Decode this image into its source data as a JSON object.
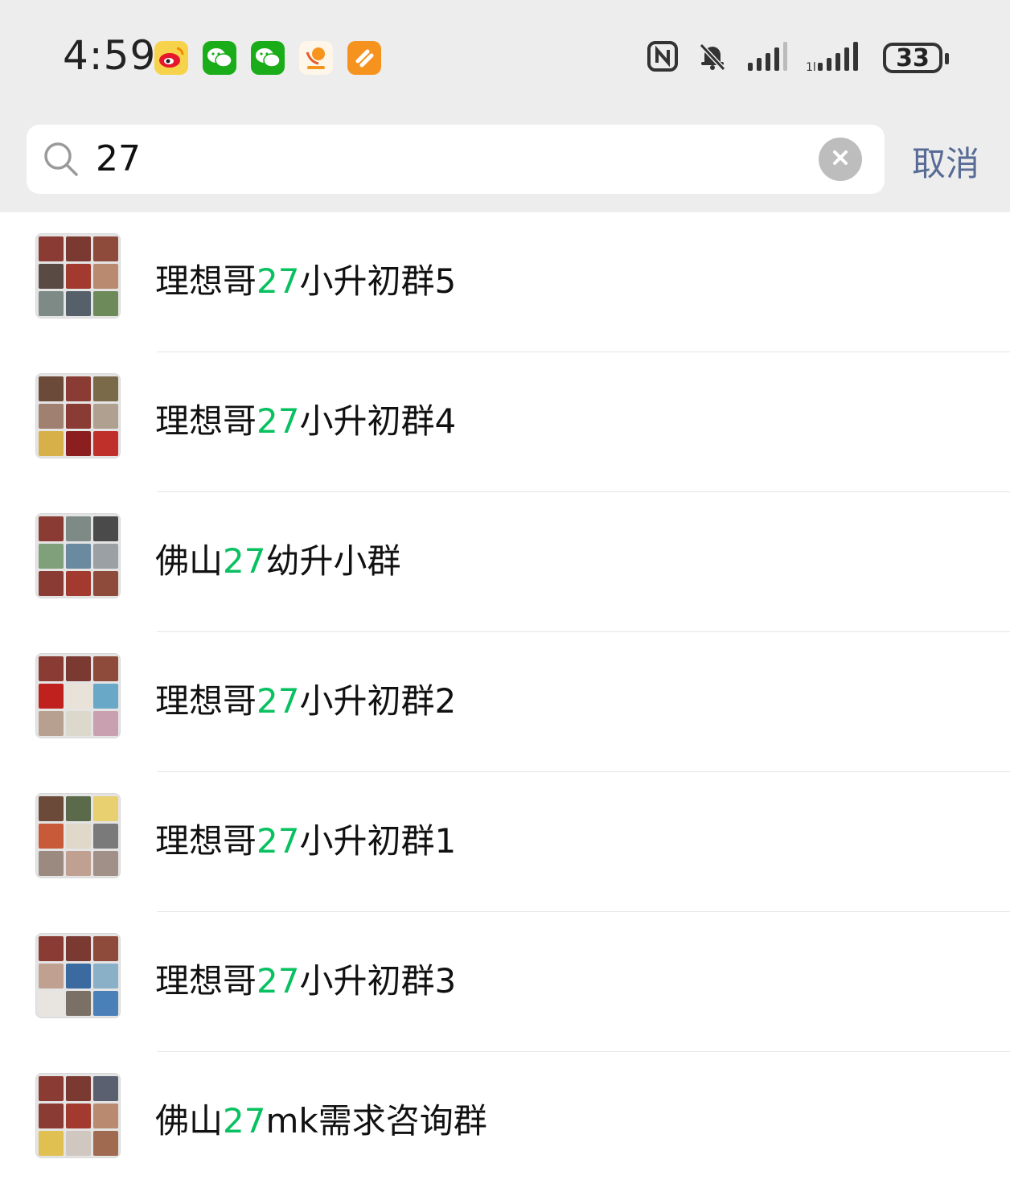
{
  "status_bar": {
    "time": "4:59",
    "notification_icons": [
      "weibo-icon",
      "wechat-icon",
      "wechat-icon",
      "xiaotiancai-icon",
      "orange-app-icon"
    ],
    "right_icons": [
      "nfc-icon",
      "bell-muted-icon",
      "signal-icon",
      "signal-icon"
    ],
    "battery": "33"
  },
  "search": {
    "query": "27",
    "cancel_label": "取消"
  },
  "results": [
    {
      "prefix": "理想哥",
      "match": "27",
      "suffix": "小升初群5"
    },
    {
      "prefix": "理想哥",
      "match": "27",
      "suffix": "小升初群4"
    },
    {
      "prefix": "佛山",
      "match": "27",
      "suffix": "幼升小群"
    },
    {
      "prefix": "理想哥",
      "match": "27",
      "suffix": "小升初群2"
    },
    {
      "prefix": "理想哥",
      "match": "27",
      "suffix": "小升初群1"
    },
    {
      "prefix": "理想哥",
      "match": "27",
      "suffix": "小升初群3"
    },
    {
      "prefix": "佛山",
      "match": "27",
      "suffix": "mk需求咨询群"
    }
  ],
  "colors": {
    "highlight": "#07c160",
    "cancel": "#576b95",
    "background_top": "#ededed"
  }
}
